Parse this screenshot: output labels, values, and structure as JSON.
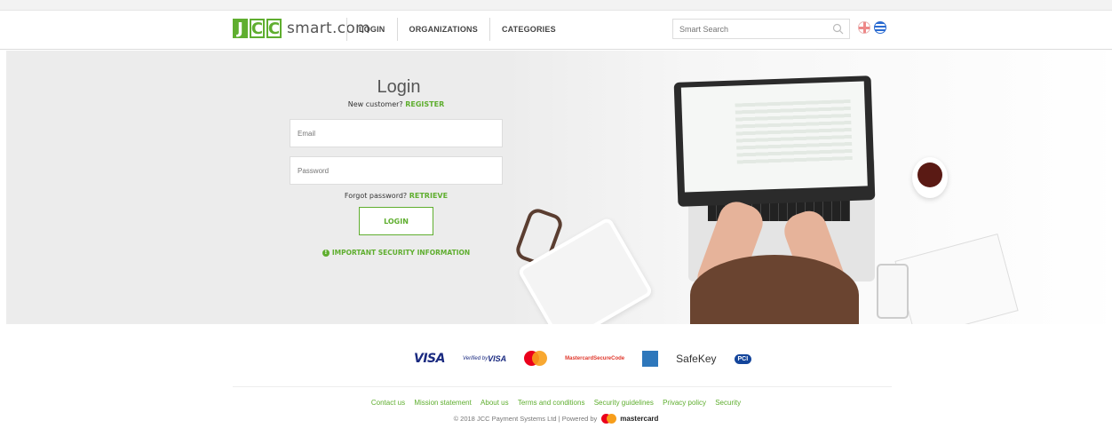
{
  "header": {
    "logo_letters": [
      "J",
      "C",
      "C"
    ],
    "logo_text": "smart.com",
    "nav": [
      "LOGIN",
      "ORGANIZATIONS",
      "CATEGORIES"
    ],
    "search_placeholder": "Smart Search",
    "languages": [
      "English",
      "Greek"
    ]
  },
  "login": {
    "title": "Login",
    "new_customer": "New customer?",
    "register": "REGISTER",
    "email_placeholder": "Email",
    "password_placeholder": "Password",
    "forgot": "Forgot password?",
    "retrieve": "RETRIEVE",
    "button": "LOGIN",
    "security_info": "IMPORTANT SECURITY INFORMATION"
  },
  "payments": {
    "visa": "VISA",
    "verified_by": "Verified by",
    "verified_visa": "VISA",
    "mastercard_securecode": [
      "Mastercard",
      "SecureCode"
    ],
    "safekey": "SafeKey",
    "pci": "PCI"
  },
  "footer": {
    "links": [
      "Contact us",
      "Mission statement",
      "About us",
      "Terms and conditions",
      "Security guidelines",
      "Privacy policy",
      "Security"
    ],
    "copyright": "© 2018 JCC Payment Systems Ltd",
    "powered_by": "Powered by",
    "mastercard": "mastercard"
  },
  "colors": {
    "accent": "#5fae2f",
    "visa": "#1a2a80"
  }
}
